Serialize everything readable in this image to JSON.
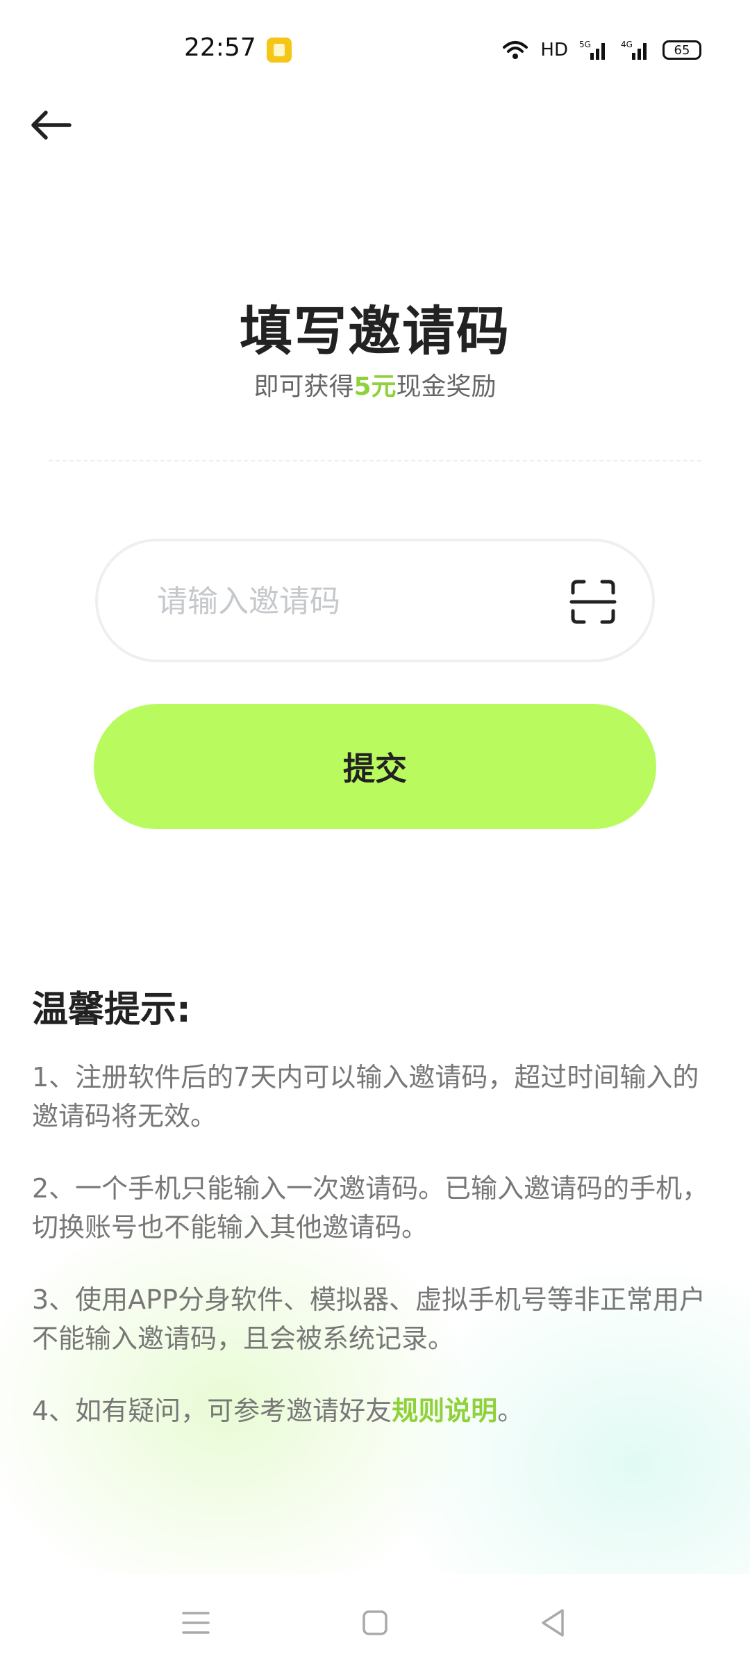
{
  "status_bar": {
    "time": "22:57",
    "network_hd": "HD",
    "network_5g": "5G",
    "network_4g": "4G",
    "battery": "65"
  },
  "header": {
    "title": "填写邀请码",
    "subtitle_prefix": "即可获得",
    "subtitle_highlight": "5元",
    "subtitle_suffix": "现金奖励"
  },
  "invite": {
    "placeholder": "请输入邀请码",
    "value": ""
  },
  "submit_label": "提交",
  "tips": {
    "title": "温馨提示:",
    "items": [
      "1、注册软件后的7天内可以输入邀请码，超过时间输入的邀请码将无效。",
      "2、一个手机只能输入一次邀请码。已输入邀请码的手机，切换账号也不能输入其他邀请码。",
      "3、使用APP分身软件、模拟器、虚拟手机号等非正常用户不能输入邀请码，且会被系统记录。"
    ],
    "item4_prefix": "4、如有疑问，可参考邀请好友",
    "item4_link": "规则说明",
    "item4_suffix": "。"
  },
  "colors": {
    "accent": "#b9fb5f",
    "highlight_text": "#8fd13a"
  },
  "icons": {
    "back": "back-arrow-icon",
    "scan": "scan-icon",
    "menu": "menu-icon",
    "home": "home-icon",
    "back_nav": "back-triangle-icon"
  }
}
